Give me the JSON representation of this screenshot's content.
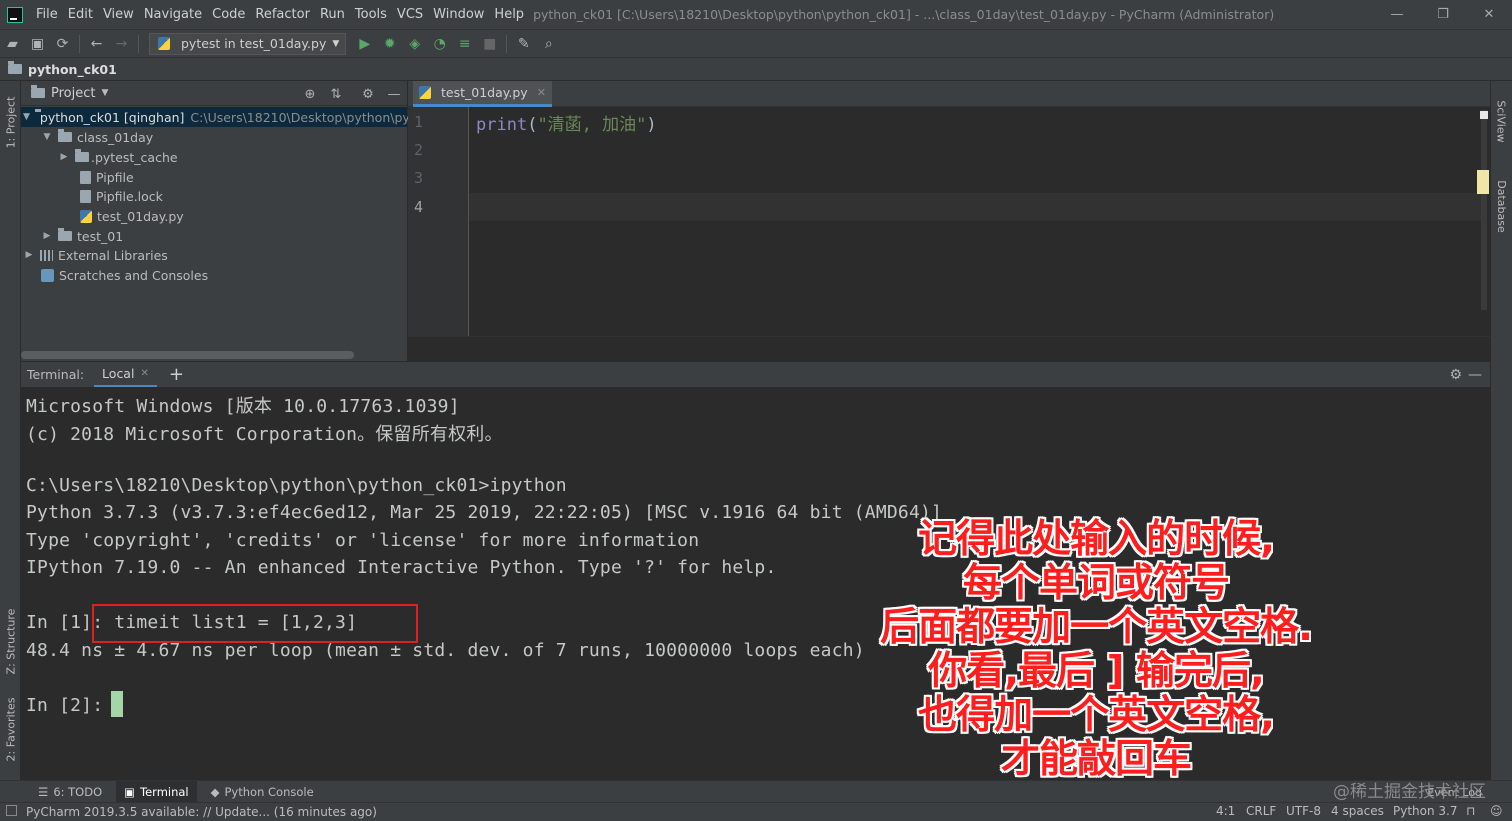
{
  "window": {
    "title": "python_ck01 [C:\\Users\\18210\\Desktop\\python\\python_ck01] - ...\\class_01day\\test_01day.py - PyCharm (Administrator)",
    "controls": [
      "—",
      "❐",
      "✕"
    ]
  },
  "menu": [
    "File",
    "Edit",
    "View",
    "Navigate",
    "Code",
    "Refactor",
    "Run",
    "Tools",
    "VCS",
    "Window",
    "Help"
  ],
  "toolbar": {
    "run_config": "pytest in test_01day.py"
  },
  "navbar": {
    "project": "python_ck01"
  },
  "side_tabs": {
    "project": "1: Project",
    "structure": "Z: Structure",
    "favorites": "2: Favorites",
    "sciview": "SciView",
    "database": "Database"
  },
  "project_panel": {
    "title": "Project",
    "tree": [
      {
        "label": "python_ck01 [qinghan]",
        "path": "C:\\Users\\18210\\Desktop\\python\\py"
      },
      {
        "label": "class_01day"
      },
      {
        "label": ".pytest_cache"
      },
      {
        "label": "Pipfile"
      },
      {
        "label": "Pipfile.lock"
      },
      {
        "label": "test_01day.py"
      },
      {
        "label": "test_01"
      },
      {
        "label": "External Libraries"
      },
      {
        "label": "Scratches and Consoles"
      }
    ]
  },
  "editor": {
    "tab": "test_01day.py",
    "line_numbers": [
      "1",
      "2",
      "3",
      "4"
    ],
    "code": {
      "fn": "print",
      "open": "(",
      "string": "\"清菡, 加油\"",
      "close": ")"
    }
  },
  "terminal": {
    "label": "Terminal:",
    "tab": "Local",
    "lines": [
      "Microsoft Windows [版本 10.0.17763.1039]",
      "(c) 2018 Microsoft Corporation。保留所有权利。",
      "",
      "C:\\Users\\18210\\Desktop\\python\\python_ck01>ipython",
      "Python 3.7.3 (v3.7.3:ef4ec6ed12, Mar 25 2019, 22:22:05) [MSC v.1916 64 bit (AMD64)]",
      "Type 'copyright', 'credits' or 'license' for more information",
      "IPython 7.19.0 -- An enhanced Interactive Python. Type '?' for help.",
      "",
      "In [1]: timeit list1 = [1,2,3]",
      "48.4 ns ± 4.67 ns per loop (mean ± std. dev. of 7 runs, 10000000 loops each)",
      "",
      "In [2]: "
    ]
  },
  "annotation": {
    "lines": [
      "记得此处输入的时候,",
      "每个单词或符号",
      "后面都要加一个英文空格.",
      "你看,最后 ] 输完后,",
      "也得加一个英文空格,",
      "才能敲回车"
    ],
    "color": "#ff1e1e"
  },
  "tool_tabs": [
    "6: TODO",
    "Terminal",
    "Python Console"
  ],
  "event_log": "Event Log",
  "watermark": "@稀土掘金技术社区",
  "status": {
    "message": "PyCharm 2019.3.5 available: // Update... (16 minutes ago)",
    "position": "4:1",
    "line_sep": "CRLF",
    "encoding": "UTF-8",
    "indent": "4 spaces",
    "interpreter": "Python 3.7"
  },
  "colors": {
    "accent": "#4a88c7",
    "highlight_box": "#e02020"
  }
}
